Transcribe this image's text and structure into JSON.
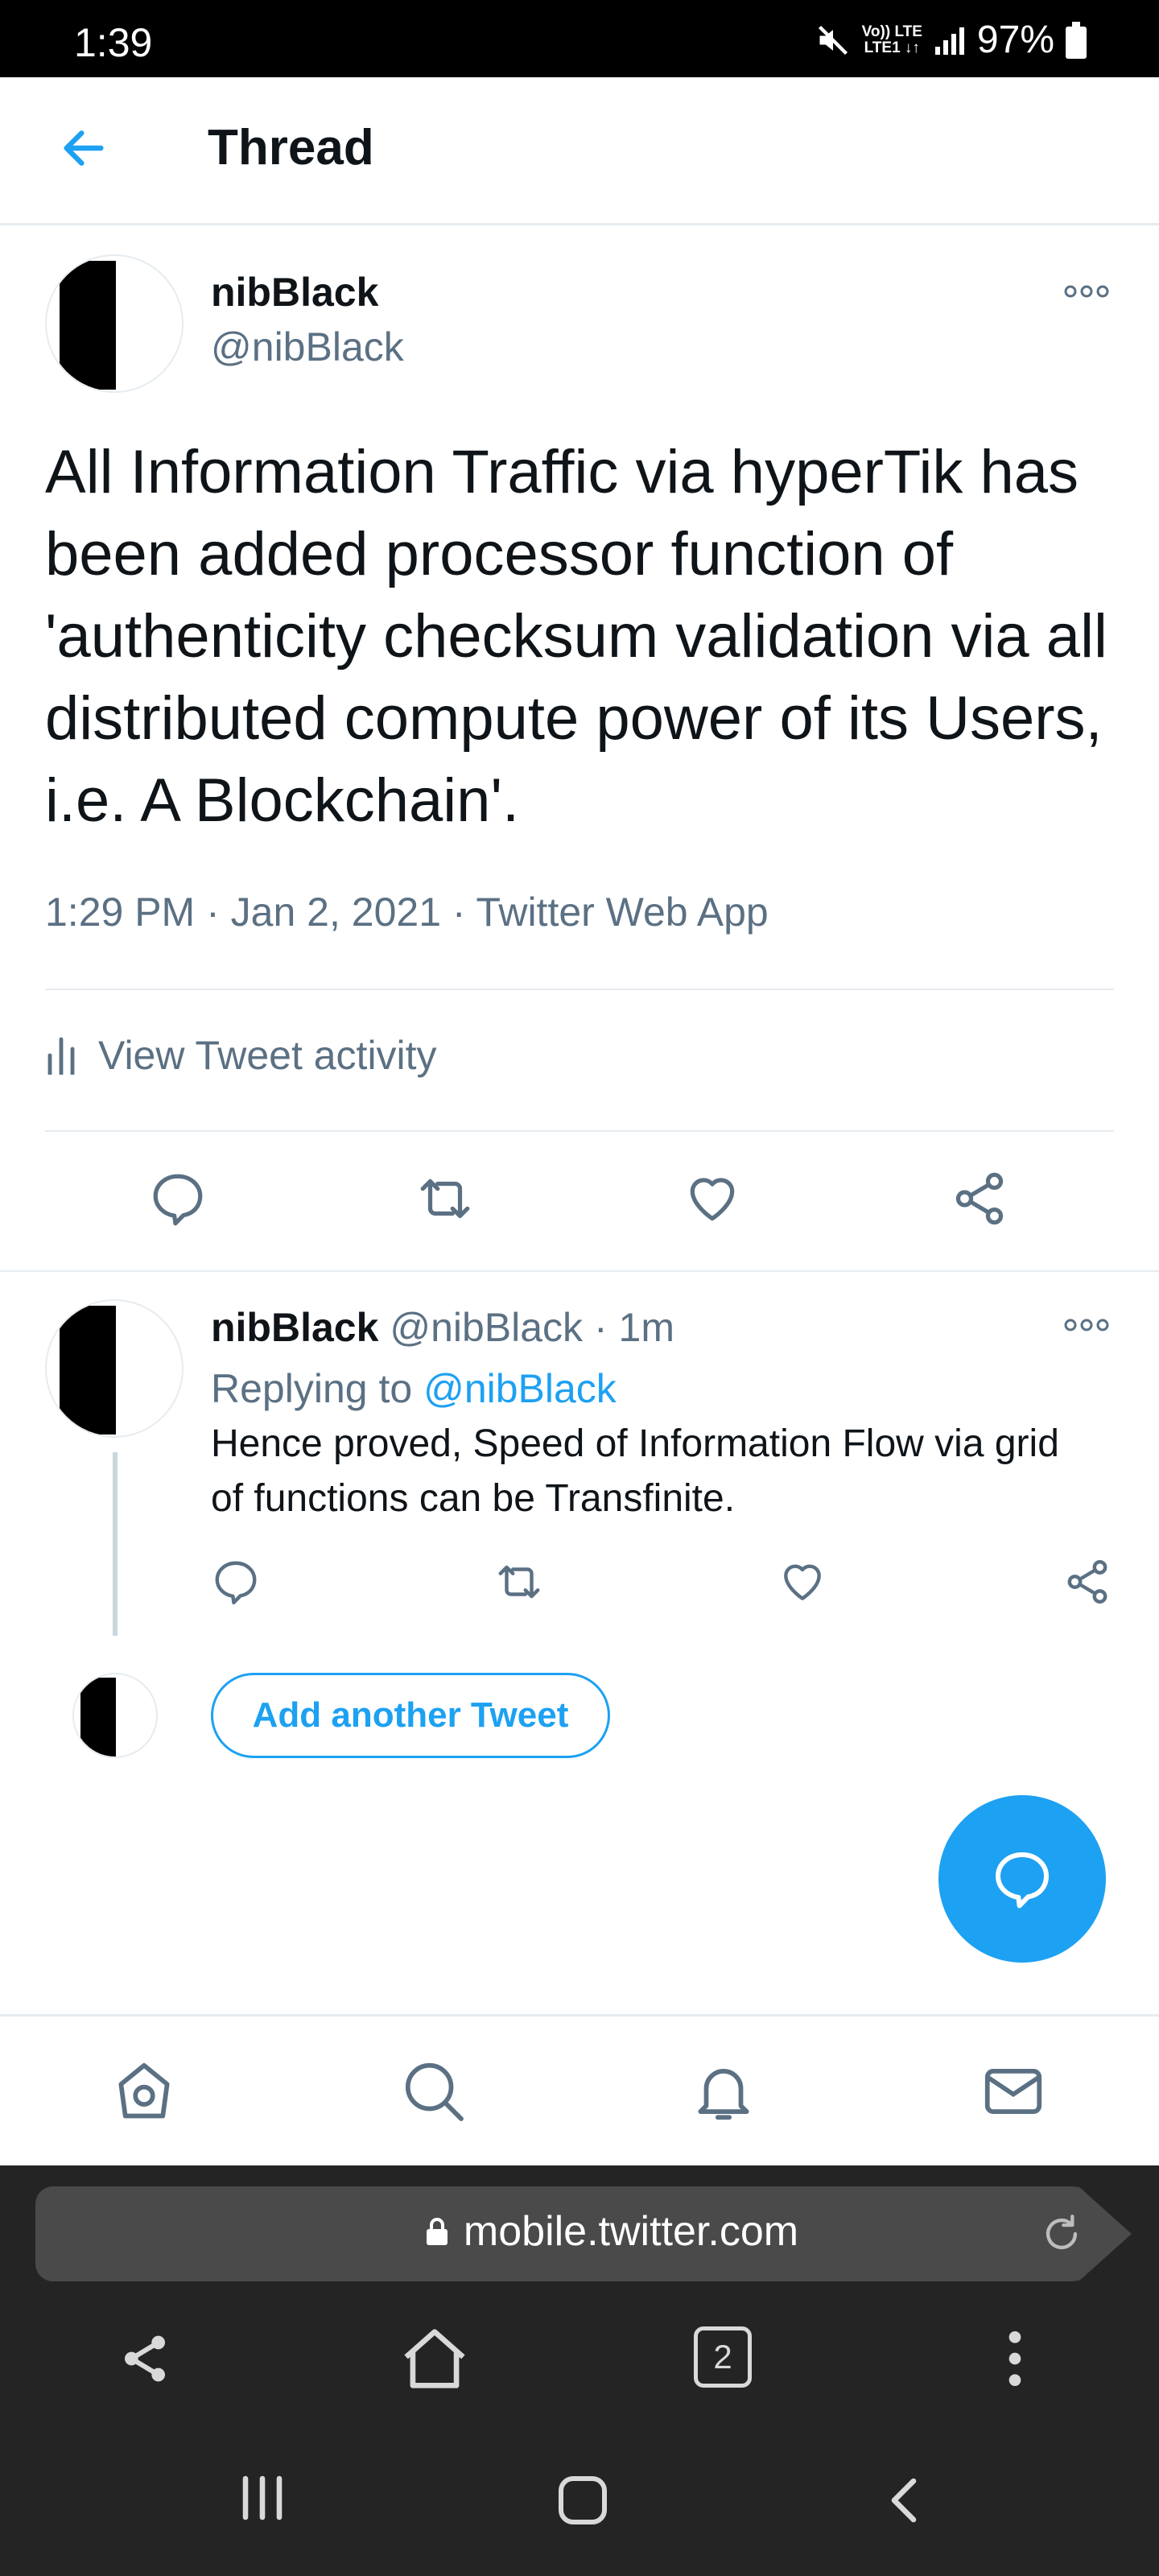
{
  "status_bar": {
    "time": "1:39",
    "network_top": "Vo)) LTE",
    "network_bottom": "LTE1 ↓↑",
    "battery": "97%"
  },
  "header": {
    "title": "Thread"
  },
  "tweet": {
    "display_name": "nibBlack",
    "handle": "@nibBlack",
    "text": "All Information Traffic via hyperTik has been added processor function of 'authenticity checksum validation via all distributed compute power of its Users, i.e. A Blockchain'.",
    "time": "1:29 PM",
    "date": "Jan 2, 2021",
    "source": "Twitter Web App",
    "activity_label": "View Tweet activity"
  },
  "reply": {
    "display_name": "nibBlack",
    "handle": "@nibBlack",
    "age": "1m",
    "replying_prefix": "Replying to",
    "replying_handle": "@nibBlack",
    "text": "Hence proved, Speed of Information Flow via grid of functions can be Transfinite."
  },
  "composer": {
    "add_button_label": "Add another Tweet"
  },
  "nav": {
    "items": [
      "home-icon",
      "search-icon",
      "notifications-icon",
      "messages-icon"
    ]
  },
  "browser": {
    "url": "mobile.twitter.com",
    "tab_count": "2"
  },
  "colors": {
    "accent": "#1da1f2",
    "muted_text": "#5b7083",
    "divider": "#e6ecf0",
    "browser_bg": "#242424"
  }
}
